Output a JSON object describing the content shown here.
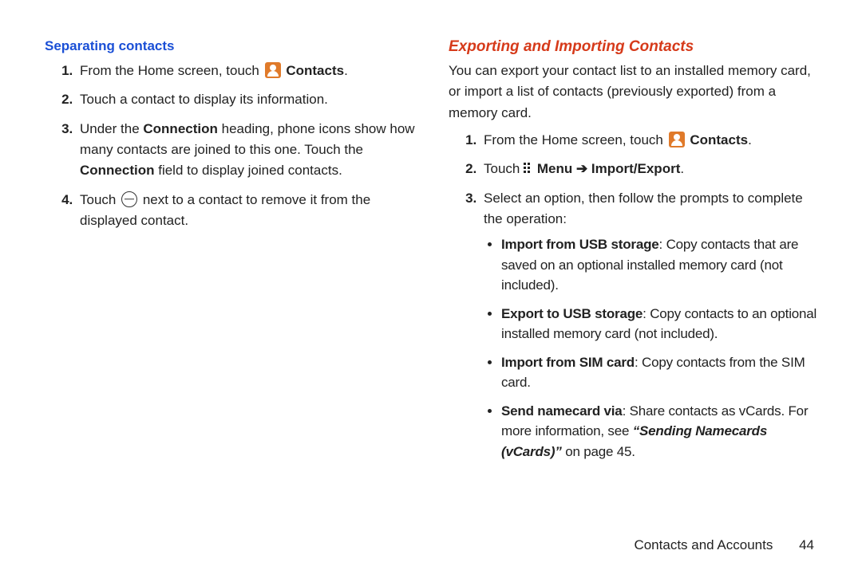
{
  "left": {
    "heading": "Separating contacts",
    "s1_a": "From the Home screen, touch ",
    "s1_b": " Contacts",
    "s1_c": ".",
    "s2": "Touch a contact to display its information.",
    "s3_a": "Under the ",
    "s3_b": "Connection",
    "s3_c": " heading, phone icons show how many contacts are joined to this one. Touch the ",
    "s3_d": "Connection",
    "s3_e": " field to display joined contacts.",
    "s4_a": "Touch ",
    "s4_b": " next to a contact to remove it from the displayed contact."
  },
  "right": {
    "heading": "Exporting and Importing Contacts",
    "intro": "You can export your contact list to an installed memory card, or import a list of contacts (previously exported) from a memory card.",
    "s1_a": "From the Home screen, touch ",
    "s1_b": " Contacts",
    "s1_c": ".",
    "s2_a": "Touch ",
    "s2_b": " Menu ",
    "s2_arrow": "➔",
    "s2_c": " Import/Export",
    "s2_d": ".",
    "s3": "Select an option, then follow the prompts to complete the operation:",
    "b1_a": "Import from USB storage",
    "b1_b": ": Copy contacts that are saved on an optional installed memory card (not included).",
    "b2_a": "Export to USB storage",
    "b2_b": ": Copy contacts to an optional installed memory card (not included).",
    "b3_a": "Import from SIM card",
    "b3_b": ": Copy contacts from the SIM card.",
    "b4_a": "Send namecard via",
    "b4_b": ": Share contacts as vCards. For more information, see ",
    "b4_c": "“Sending Namecards (vCards)”",
    "b4_d": " on page 45."
  },
  "footer": {
    "section": "Contacts and Accounts",
    "page": "44"
  }
}
